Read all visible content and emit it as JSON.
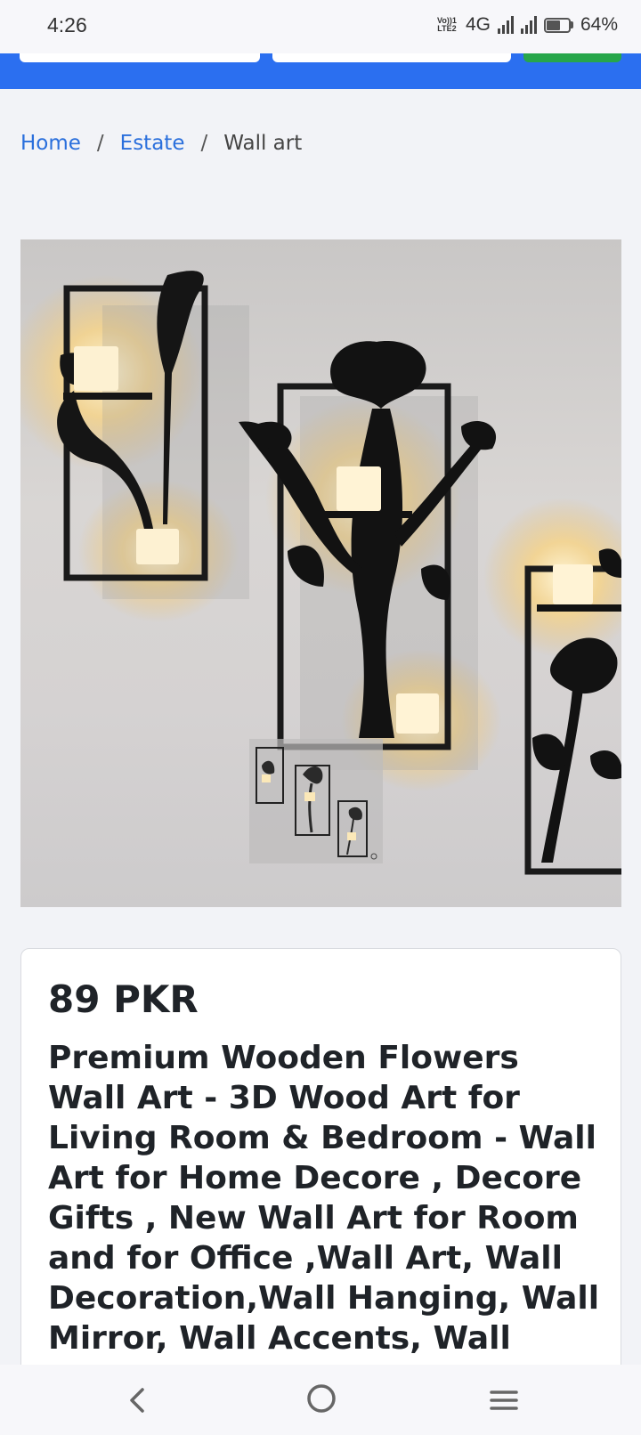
{
  "status_bar": {
    "time": "4:26",
    "network": "4G",
    "volte_top": "Vo))1",
    "volte_bottom": "LTE2",
    "battery": "64%",
    "battery_level": 0.64
  },
  "breadcrumb": {
    "home": "Home",
    "category": "Estate",
    "current": "Wall art",
    "separator": "/"
  },
  "product": {
    "image_icon": "wall-art-photo",
    "price": "89 PKR",
    "title": "Premium Wooden Flowers Wall Art - 3D Wood Art for Living Room & Bedroom - Wall Art for Home Decore , Decore Gifts , New Wall Art for Room and for Office ,Wall Art, Wall Decoration,Wall Hanging, Wall Mirror, Wall Accents, Wall"
  },
  "nav": {
    "back_icon": "back-chevron-icon",
    "home_icon": "home-circle-icon",
    "menu_icon": "menu-lines-icon"
  },
  "colors": {
    "header_blue": "#2b6ff0",
    "accent_green": "#27a64a",
    "link_blue": "#2a6fdc"
  }
}
